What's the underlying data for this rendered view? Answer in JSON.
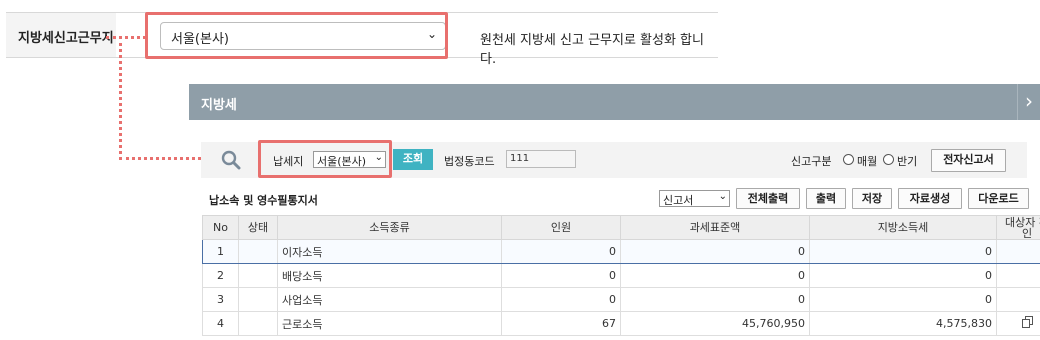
{
  "top_setting": {
    "label": "지방세신고근무지",
    "select_value": "서울(본사)",
    "description": "원천세 지방세 신고 근무지로 활성화 합니다."
  },
  "panel": {
    "title": "지방세",
    "search": {
      "tax_place_label": "납세지",
      "tax_place_value": "서울(본사)",
      "query_button": "조회",
      "legal_dong_code_label": "법정동코드",
      "legal_dong_code_value": "111",
      "report_type_label": "신고구분",
      "radio_monthly": "매월",
      "radio_half": "반기",
      "e_filing_button": "전자신고서"
    },
    "toolbar": {
      "title": "납소속 및 영수필통지서",
      "doc_select": "신고서",
      "buttons": [
        "전체출력",
        "출력",
        "저장",
        "자료생성",
        "다운로드"
      ]
    },
    "table": {
      "headers": [
        "No",
        "상태",
        "소득종류",
        "인원",
        "과세표준액",
        "지방소득세",
        "대상자 확인"
      ],
      "rows": [
        {
          "no": "1",
          "status": "",
          "type": "이자소득",
          "count": "0",
          "tax_base": "0",
          "local_tax": "0",
          "check": ""
        },
        {
          "no": "2",
          "status": "",
          "type": "배당소득",
          "count": "0",
          "tax_base": "0",
          "local_tax": "0",
          "check": ""
        },
        {
          "no": "3",
          "status": "",
          "type": "사업소득",
          "count": "0",
          "tax_base": "0",
          "local_tax": "0",
          "check": ""
        },
        {
          "no": "4",
          "status": "",
          "type": "근로소득",
          "count": "67",
          "tax_base": "45,760,950",
          "local_tax": "4,575,830",
          "check": "copy-icon"
        }
      ]
    }
  },
  "colors": {
    "highlight": "#e8706e",
    "header_bar": "#8f9ea8",
    "query_button": "#3fb3c2"
  }
}
